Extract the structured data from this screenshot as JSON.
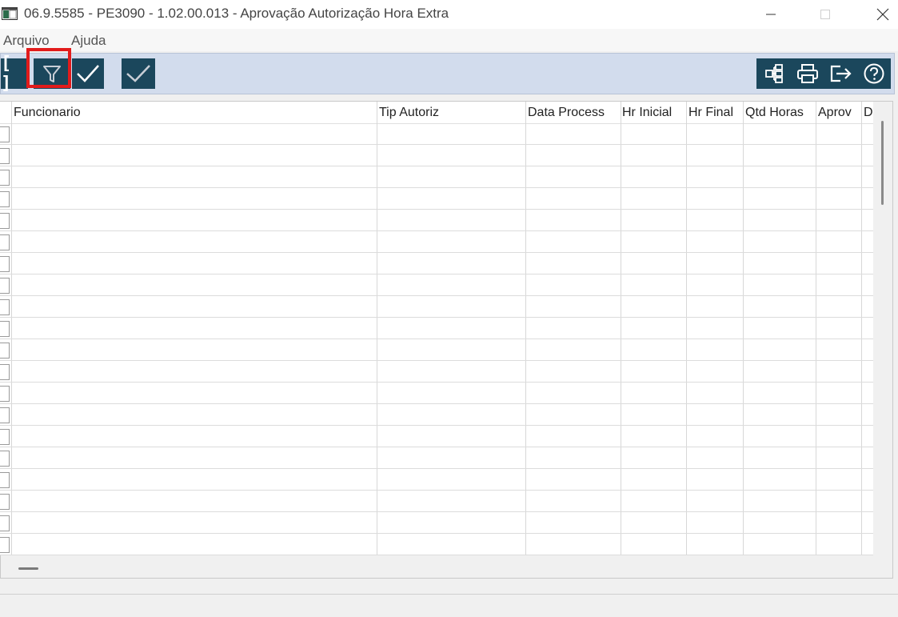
{
  "window": {
    "title": "06.9.5585 - PE3090 - 1.02.00.013 - Aprovação Autorização Hora Extra",
    "app_icon": "app-window-icon"
  },
  "window_controls": {
    "minimize_icon": "minimize-icon",
    "maximize_icon": "maximize-icon",
    "close_icon": "close-icon"
  },
  "menu": {
    "items": [
      {
        "label": "Arquivo"
      },
      {
        "label": "Ajuda"
      }
    ]
  },
  "toolbar": {
    "left_buttons": [
      {
        "icon": "bracket-icon",
        "label": "[ ]"
      },
      {
        "icon": "filter-icon"
      },
      {
        "icon": "check-icon"
      },
      {
        "icon": "check-icon"
      }
    ],
    "right_buttons": [
      {
        "icon": "tree-structure-icon"
      },
      {
        "icon": "printer-icon"
      },
      {
        "icon": "exit-icon"
      },
      {
        "icon": "help-icon"
      }
    ],
    "highlighted_button": "filter-icon",
    "colors": {
      "toolbar_bg": "#d2dced",
      "button_bg": "#1b475c",
      "highlight": "#e21b1b"
    }
  },
  "grid": {
    "columns": [
      {
        "label": "Funcionario"
      },
      {
        "label": "Tip Autoriz"
      },
      {
        "label": "Data Process"
      },
      {
        "label": "Hr Inicial"
      },
      {
        "label": "Hr Final"
      },
      {
        "label": "Qtd Horas"
      },
      {
        "label": "Aprov"
      },
      {
        "label": "D"
      }
    ],
    "rows": [
      [
        "",
        "",
        "",
        "",
        "",
        "",
        "",
        ""
      ],
      [
        "",
        "",
        "",
        "",
        "",
        "",
        "",
        ""
      ],
      [
        "",
        "",
        "",
        "",
        "",
        "",
        "",
        ""
      ],
      [
        "",
        "",
        "",
        "",
        "",
        "",
        "",
        ""
      ],
      [
        "",
        "",
        "",
        "",
        "",
        "",
        "",
        ""
      ],
      [
        "",
        "",
        "",
        "",
        "",
        "",
        "",
        ""
      ],
      [
        "",
        "",
        "",
        "",
        "",
        "",
        "",
        ""
      ],
      [
        "",
        "",
        "",
        "",
        "",
        "",
        "",
        ""
      ],
      [
        "",
        "",
        "",
        "",
        "",
        "",
        "",
        ""
      ],
      [
        "",
        "",
        "",
        "",
        "",
        "",
        "",
        ""
      ],
      [
        "",
        "",
        "",
        "",
        "",
        "",
        "",
        ""
      ],
      [
        "",
        "",
        "",
        "",
        "",
        "",
        "",
        ""
      ],
      [
        "",
        "",
        "",
        "",
        "",
        "",
        "",
        ""
      ],
      [
        "",
        "",
        "",
        "",
        "",
        "",
        "",
        ""
      ],
      [
        "",
        "",
        "",
        "",
        "",
        "",
        "",
        ""
      ],
      [
        "",
        "",
        "",
        "",
        "",
        "",
        "",
        ""
      ],
      [
        "",
        "",
        "",
        "",
        "",
        "",
        "",
        ""
      ],
      [
        "",
        "",
        "",
        "",
        "",
        "",
        "",
        ""
      ],
      [
        "",
        "",
        "",
        "",
        "",
        "",
        "",
        ""
      ],
      [
        "",
        "",
        "",
        "",
        "",
        "",
        "",
        ""
      ]
    ]
  }
}
